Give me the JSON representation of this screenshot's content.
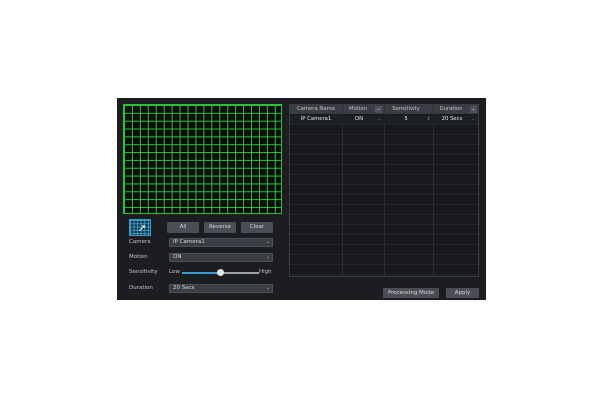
{
  "buttons": {
    "all": "All",
    "reverse": "Reverse",
    "clear": "Clear",
    "processing_mode": "Processing Mode",
    "apply": "Apply"
  },
  "fields": {
    "camera": {
      "label": "Camera",
      "value": "IP Camera1"
    },
    "motion": {
      "label": "Motion",
      "value": "ON"
    },
    "sensitivity": {
      "label": "Sensitivity",
      "low": "Low",
      "high": "High",
      "level": 0.5
    },
    "duration": {
      "label": "Duration",
      "value": "20 Secs"
    }
  },
  "table": {
    "headers": [
      "Camera Name",
      "Motion",
      "Sensitivity",
      "Duration"
    ],
    "rows": [
      {
        "camera": "IP Camera1",
        "motion": "ON",
        "sensitivity": "5",
        "duration": "20 Secs"
      }
    ]
  },
  "colors": {
    "grid": "#2cc23a",
    "accent": "#3a9ad0",
    "panel": "#1b1d21"
  },
  "icons": {
    "chevron": "chevron-down-icon",
    "stepper": "stepper-icon",
    "cursor": "cursor-icon"
  }
}
